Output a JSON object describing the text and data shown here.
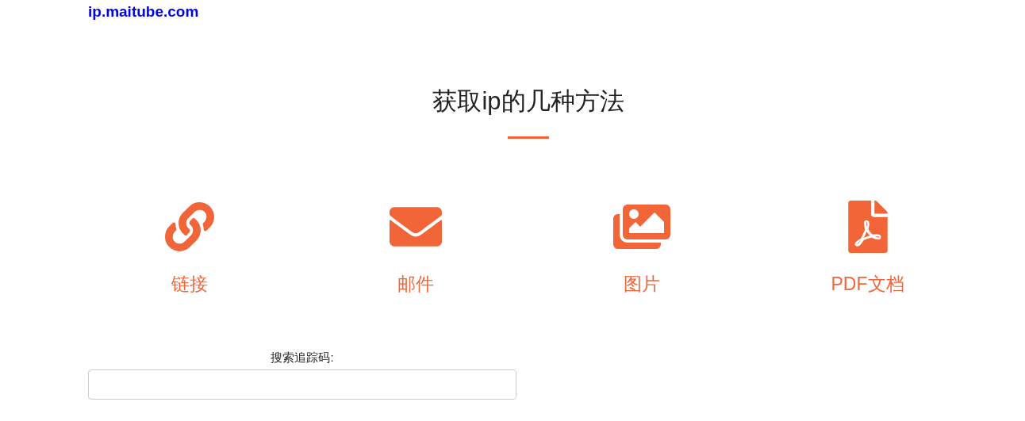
{
  "site_link": "ip.maitube.com",
  "heading": "获取ip的几种方法",
  "methods": [
    {
      "kind": "link",
      "label": "链接"
    },
    {
      "kind": "mail",
      "label": "邮件"
    },
    {
      "kind": "image",
      "label": "图片"
    },
    {
      "kind": "pdf",
      "label": "PDF文档"
    }
  ],
  "search": {
    "label": "搜索追踪码:"
  }
}
